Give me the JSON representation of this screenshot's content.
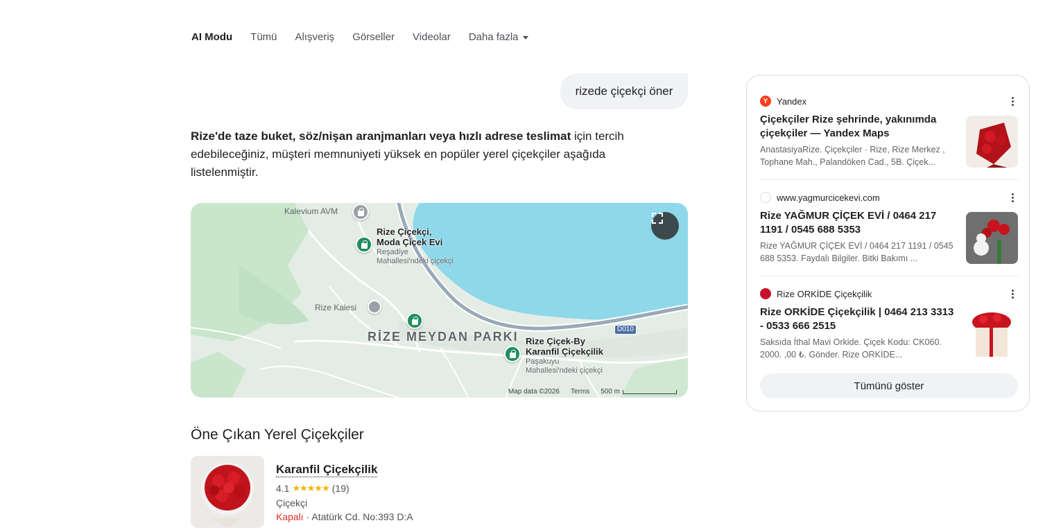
{
  "tabs": [
    {
      "label": "AI Modu"
    },
    {
      "label": "Tümü"
    },
    {
      "label": "Alışveriş"
    },
    {
      "label": "Görseller"
    },
    {
      "label": "Videolar"
    },
    {
      "label": "Daha fazla"
    }
  ],
  "query": "rizede çiçekçi öner",
  "answer": {
    "bold": "Rize'de taze buket, söz/nişan aranjmanları veya hızlı adrese teslimat",
    "rest": " için tercih edebileceğiniz, müşteri memnuniyeti yüksek en popüler yerel çiçekçiler aşağıda listelenmiştir."
  },
  "map": {
    "labels": {
      "kalevium": "Kalevium AVM",
      "rize_kalesi": "Rize Kalesi",
      "park": "RİZE MEYDAN PARKI",
      "road": "D010"
    },
    "poi1": {
      "title_line1": "Rize Çiçekçi,",
      "title_line2": "Moda Çiçek Evi",
      "sub_line1": "Reşadiye",
      "sub_line2": "Mahallesi'ndeki çiçekçi"
    },
    "poi2": {
      "title_line1": "Rize Çiçek-By",
      "title_line2": "Karanfil Çiçekçilik",
      "sub_line1": "Paşakuyu",
      "sub_line2": "Mahallesi'ndeki çiçekçi"
    },
    "footer": {
      "attribution": "Map data ©2026",
      "terms": "Terms",
      "scale": "500 m"
    },
    "colors": {
      "sea": "#8ed8ea",
      "land": "#e4ede5",
      "green": "#c9e6cd",
      "pin": "#1e8e5e"
    }
  },
  "section_title": "Öne Çıkan Yerel Çiçekçiler",
  "place": {
    "name": "Karanfil Çiçekçilik",
    "rating": "4.1",
    "stars": "★★★★★",
    "reviews": "(19)",
    "type": "Çiçekçi",
    "status": "Kapalı",
    "address": " · Atatürk Cd. No:393 D:A"
  },
  "sources": [
    {
      "site": "Yandex",
      "favicon": "Y",
      "favicon_color": "#fc3f1d",
      "title": "Çiçekçiler Rize şehrinde, yakınımda çiçekçiler — Yandex Maps",
      "snippet": "AnastasiyaRize. Çiçekçiler · Rize, Rize Merkez , Tophane Mah., Palandöken Cad., 5B. Çiçek..."
    },
    {
      "site": "www.yagmurcicekevi.com",
      "favicon": "",
      "favicon_color": "#e8eaed",
      "title": "Rize YAĞMUR ÇİÇEK EVİ / 0464 217 1191 / 0545 688 5353",
      "snippet": "Rize YAĞMUR ÇİÇEK EVİ / 0464 217 1191 / 0545 688 5353. Faydalı Bilgiler. Bitki Bakımı ..."
    },
    {
      "site": "Rize ORKİDE Çiçekçilik",
      "favicon": "",
      "favicon_color": "#c8102e",
      "title": "Rize ORKİDE Çiçekçilik | 0464 213 3313 - 0533 666 2515",
      "snippet": "Saksıda İthal Mavi Orkide. Çiçek Kodu: CK060. 2000. ,00 ₺. Gönder. Rize ORKİDE..."
    }
  ],
  "show_all": "Tümünü göster"
}
